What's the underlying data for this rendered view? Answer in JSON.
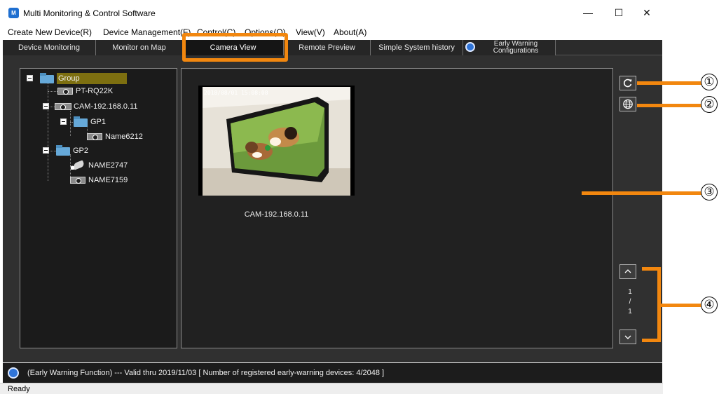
{
  "window": {
    "title": "Multi Monitoring & Control Software",
    "min_label": "—",
    "max_label": "☐",
    "close_label": "✕"
  },
  "menu": [
    "Create New Device(R)",
    "Device Management(F)",
    "Control(C)",
    "Options(O)",
    "View(V)",
    "About(A)"
  ],
  "tabs": [
    {
      "label": "Device Monitoring"
    },
    {
      "label": "Monitor on Map"
    },
    {
      "label": "Camera View"
    },
    {
      "label": "Remote Preview"
    },
    {
      "label": "Simple System history"
    },
    {
      "label_line1": "Early Warning",
      "label_line2": "Configurations"
    }
  ],
  "active_tab": "Camera View",
  "tree": [
    {
      "label": "Group",
      "type": "group",
      "level": 0
    },
    {
      "label": "PT-RQ22K",
      "type": "projector",
      "level": 1
    },
    {
      "label": "CAM-192.168.0.11",
      "type": "camera",
      "level": 1
    },
    {
      "label": "GP1",
      "type": "group",
      "level": 2
    },
    {
      "label": "Name6212",
      "type": "projector",
      "level": 3
    },
    {
      "label": "GP2",
      "type": "group",
      "level": 1
    },
    {
      "label": "NAME2747",
      "type": "camera",
      "level": 2
    },
    {
      "label": "NAME7159",
      "type": "projector",
      "level": 2
    }
  ],
  "preview": {
    "camera_name": "CAM-192.168.0.11",
    "osd_text": "2018/08/01 15:08:08"
  },
  "pager": {
    "current": "1",
    "separator": "/",
    "total": "1"
  },
  "status": {
    "early_warning": "(Early Warning Function) --- Valid thru 2019/11/03  [ Number of registered early-warning devices: 4/2048 ]",
    "ready": "Ready"
  },
  "callouts": [
    "①",
    "②",
    "③",
    "④"
  ],
  "colors": {
    "callout_orange": "#f2870f",
    "panel_dark": "#212121",
    "accent_blue": "#2f74d8",
    "tree_highlight": "#7d6f10"
  },
  "icons": {
    "refresh": "refresh-icon",
    "web": "globe-icon",
    "page_up": "chevron-up-icon",
    "page_down": "chevron-down-icon",
    "early_warning": "early-warning-icon"
  }
}
